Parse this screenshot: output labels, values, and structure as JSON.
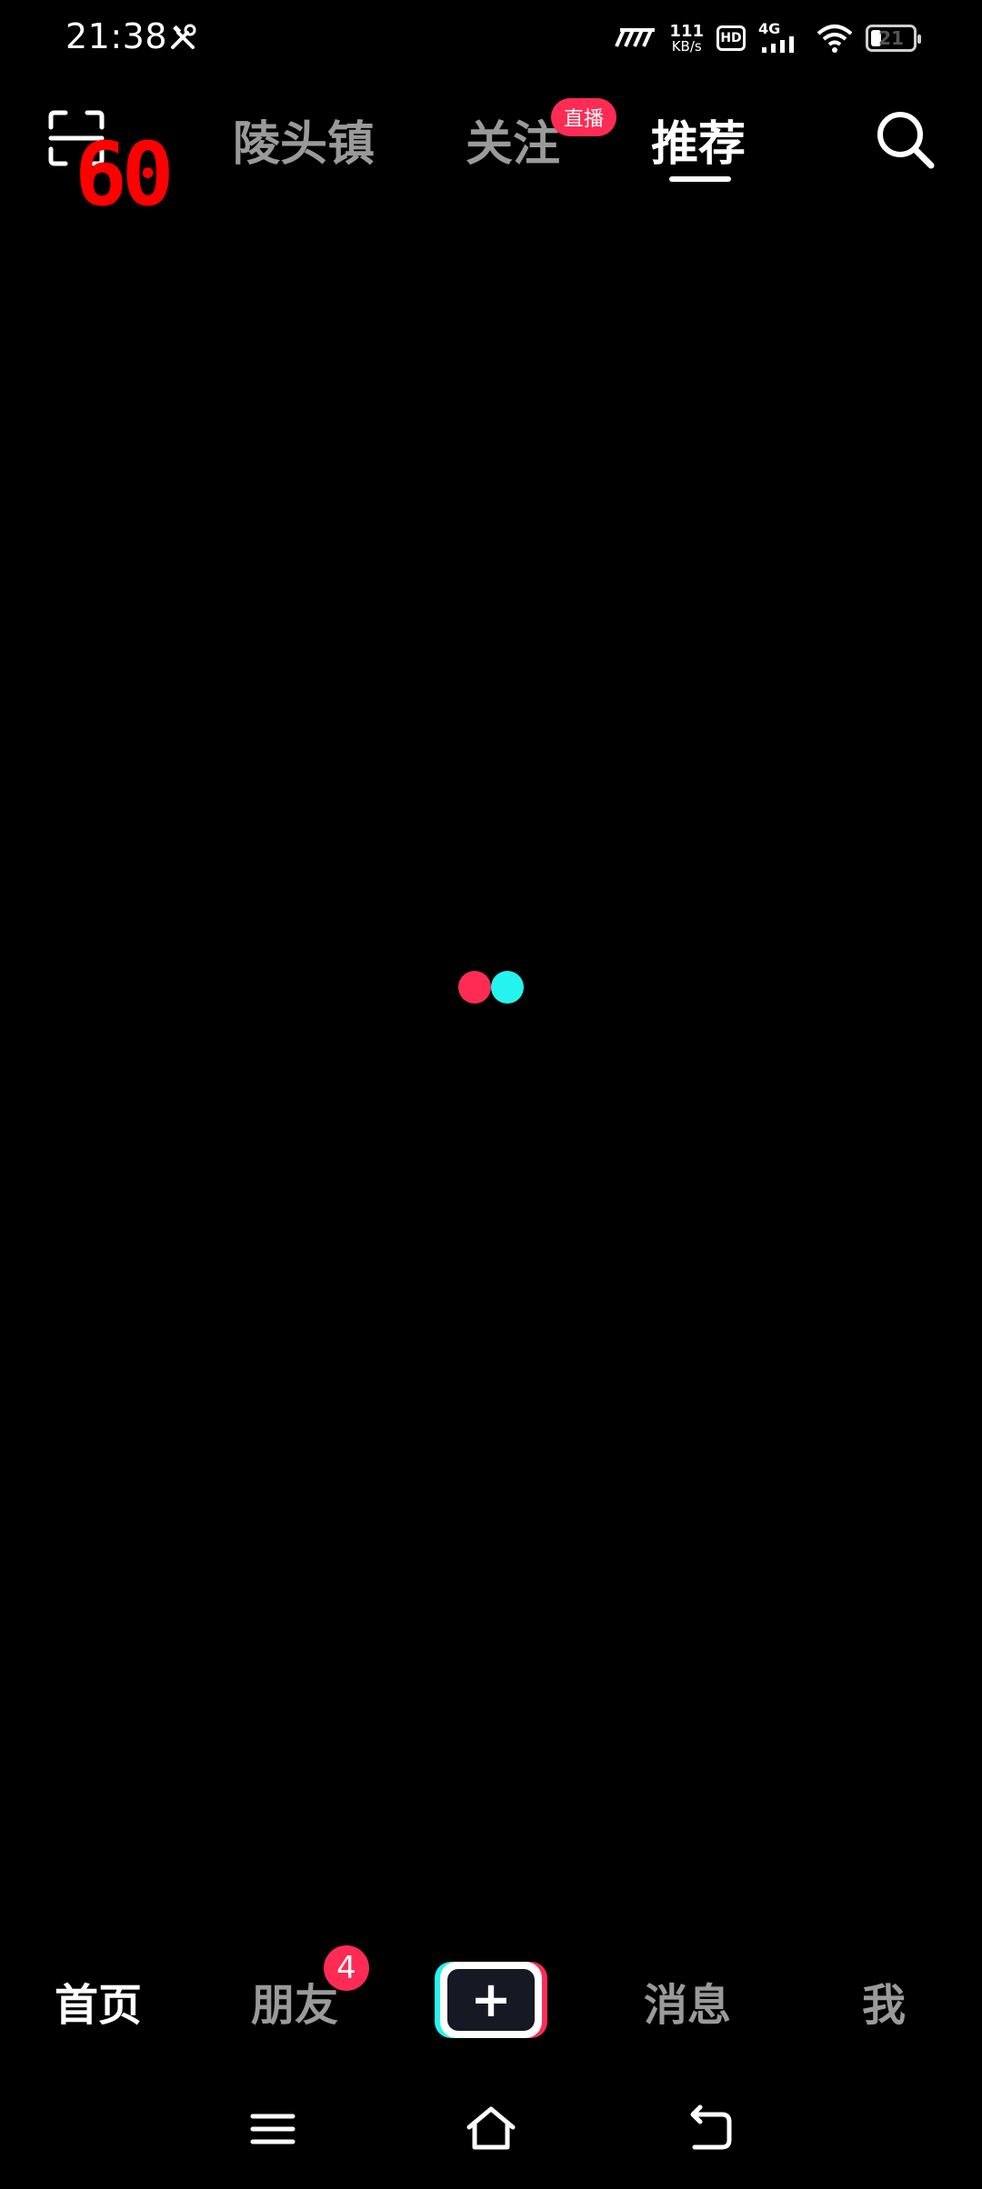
{
  "status_bar": {
    "time": "21:38",
    "net_speed_value": "111",
    "net_speed_unit": "KB/s",
    "hd_label": "HD",
    "network_type": "4G",
    "battery_level": "21"
  },
  "fps_counter": "60",
  "top_nav": {
    "tabs": [
      {
        "label": "陵头镇"
      },
      {
        "label": "关注"
      },
      {
        "label": "推荐"
      }
    ],
    "live_badge": "直播",
    "active_tab": "推荐"
  },
  "bottom_nav": {
    "items": [
      {
        "label": "首页"
      },
      {
        "label": "朋友"
      },
      {
        "label": "消息"
      },
      {
        "label": "我"
      }
    ],
    "friends_badge_count": "4",
    "create_symbol": "+"
  },
  "colors": {
    "background": "#000000",
    "accent_red": "#fe2c55",
    "accent_cyan": "#25f4ee",
    "inactive_text": "#9a9a9a",
    "active_text": "#ffffff",
    "fps_overlay": "#ff0000"
  },
  "icons": {
    "scan": "scan-icon",
    "search": "search-icon",
    "tool": "tools-icon",
    "signal": "signal-icon",
    "wifi": "wifi-icon",
    "menu": "menu-icon",
    "home": "home-icon",
    "back": "back-icon"
  }
}
